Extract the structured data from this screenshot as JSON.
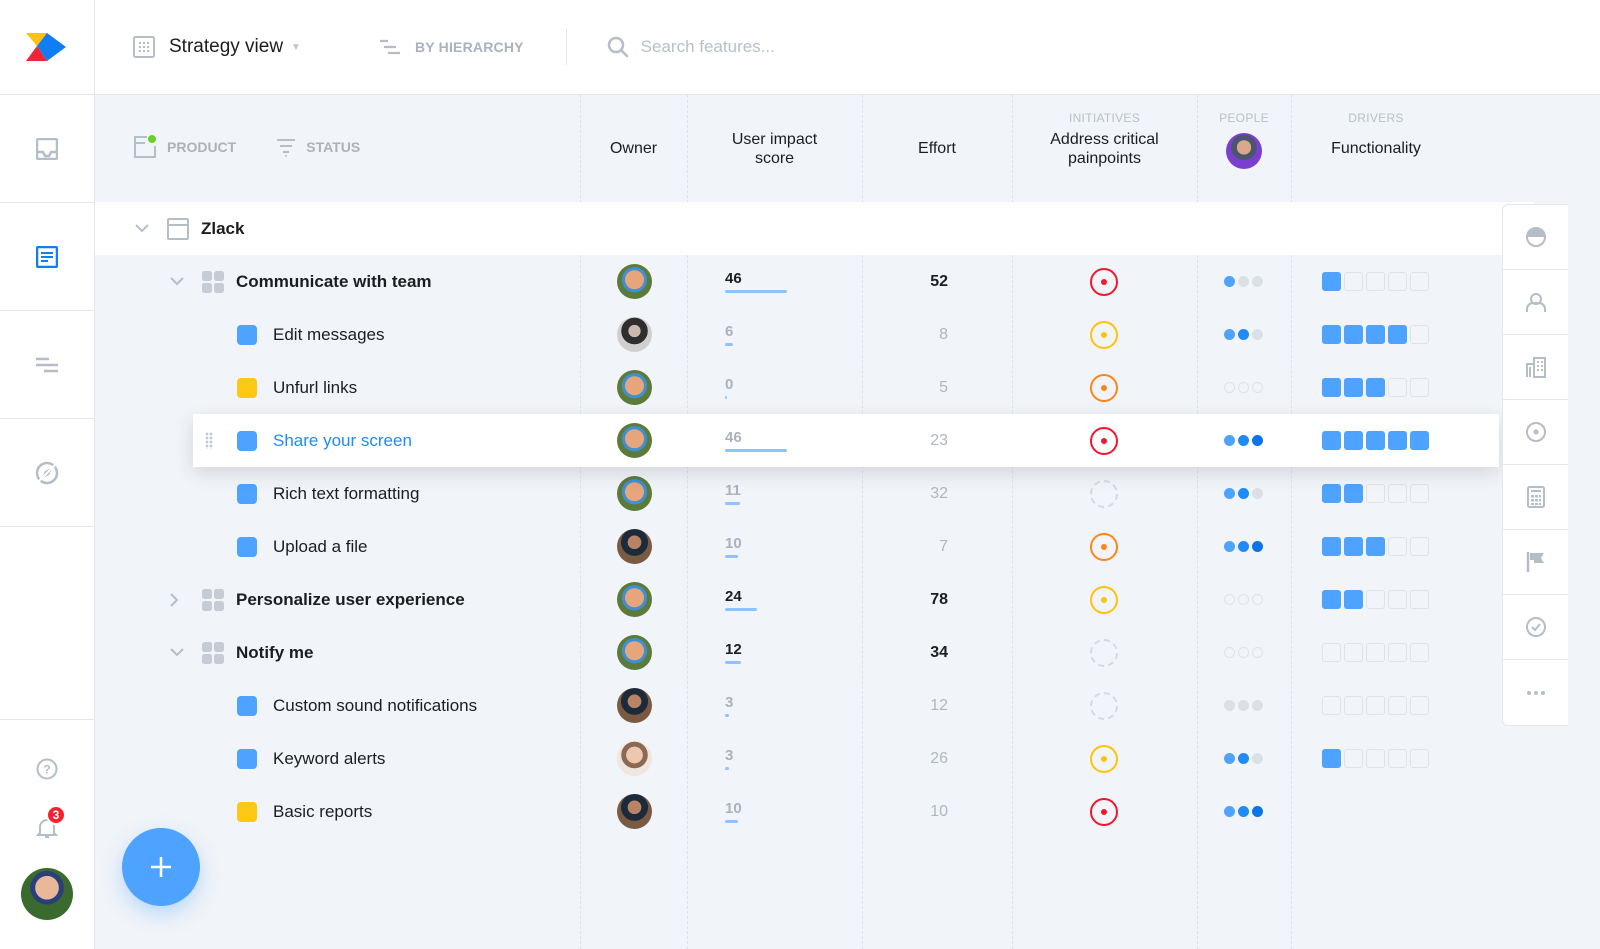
{
  "topbar": {
    "view_label": "Strategy view",
    "grouping_label": "BY HIERARCHY",
    "search_placeholder": "Search features..."
  },
  "leftnav": {
    "items": [
      "inbox-icon",
      "features-icon",
      "roadmap-icon",
      "insights-icon"
    ],
    "active_item": "features-icon",
    "notifications_count": "3"
  },
  "columns": {
    "product_filter": "PRODUCT",
    "status_filter": "STATUS",
    "owner": "Owner",
    "user_impact_line1": "User impact",
    "user_impact_line2": "score",
    "effort": "Effort",
    "initiatives_group": "INITIATIVES",
    "initiative_line1": "Address critical",
    "initiative_line2": "painpoints",
    "people_group": "PEOPLE",
    "drivers_group": "DRIVERS",
    "driver": "Functionality"
  },
  "colors": {
    "accent": "#4da3ff",
    "red": "#f0182e",
    "orange": "#ff8419",
    "yellow": "#ffc20e",
    "status_blue": "#4da3ff",
    "status_yellow": "#ffc814"
  },
  "product": {
    "name": "Zlack"
  },
  "rows": [
    {
      "level": 1,
      "name": "Communicate with team",
      "expanded": true,
      "owner": "av-a",
      "impact": 46,
      "effort": 52,
      "initiative": "red",
      "people": [
        1,
        0,
        0
      ],
      "driver": 1
    },
    {
      "level": 2,
      "name": "Edit messages",
      "status": "blue",
      "owner": "av-b",
      "impact": 6,
      "effort": 8,
      "initiative": "yellow",
      "people": [
        1,
        2,
        0
      ],
      "driver": 4
    },
    {
      "level": 2,
      "name": "Unfurl links",
      "status": "yellow",
      "owner": "av-a",
      "impact": 0,
      "effort": 5,
      "initiative": "orange",
      "people": [
        -1,
        -1,
        -1
      ],
      "driver": 3
    },
    {
      "level": 2,
      "name": "Share your screen",
      "status": "blue",
      "owner": "av-a",
      "impact": 46,
      "effort": 23,
      "initiative": "red",
      "people": [
        1,
        2,
        3
      ],
      "driver": 5,
      "highlight": true
    },
    {
      "level": 2,
      "name": "Rich text formatting",
      "status": "blue",
      "owner": "av-a",
      "impact": 11,
      "effort": 32,
      "initiative": "none",
      "people": [
        1,
        2,
        0
      ],
      "driver": 2
    },
    {
      "level": 2,
      "name": "Upload a file",
      "status": "blue",
      "owner": "av-c",
      "impact": 10,
      "effort": 7,
      "initiative": "orange",
      "people": [
        1,
        2,
        3
      ],
      "driver": 3
    },
    {
      "level": 1,
      "name": "Personalize user experience",
      "expanded": false,
      "owner": "av-a",
      "impact": 24,
      "effort": 78,
      "initiative": "yellow",
      "people": [
        -1,
        -1,
        -1
      ],
      "driver": 2
    },
    {
      "level": 1,
      "name": "Notify me",
      "expanded": true,
      "owner": "av-a",
      "impact": 12,
      "effort": 34,
      "initiative": "none",
      "people": [
        -1,
        -1,
        -1
      ],
      "driver": 0
    },
    {
      "level": 2,
      "name": "Custom sound notifications",
      "status": "blue",
      "owner": "av-c",
      "impact": 3,
      "effort": 12,
      "initiative": "none",
      "people": [
        0,
        0,
        0
      ],
      "driver": 0
    },
    {
      "level": 2,
      "name": "Keyword alerts",
      "status": "blue",
      "owner": "av-d",
      "impact": 3,
      "effort": 26,
      "initiative": "yellow",
      "people": [
        1,
        2,
        0
      ],
      "driver": 1
    },
    {
      "level": 2,
      "name": "Basic reports",
      "status": "yellow",
      "owner": "av-c",
      "impact": 10,
      "effort": 10,
      "initiative": "red",
      "people": [
        1,
        2,
        3
      ],
      "driver": null
    }
  ],
  "rail": [
    "pie-chart-icon",
    "user-icon",
    "building-icon",
    "target-icon",
    "calculator-icon",
    "flag-icon",
    "check-circle-icon",
    "more-icon"
  ]
}
